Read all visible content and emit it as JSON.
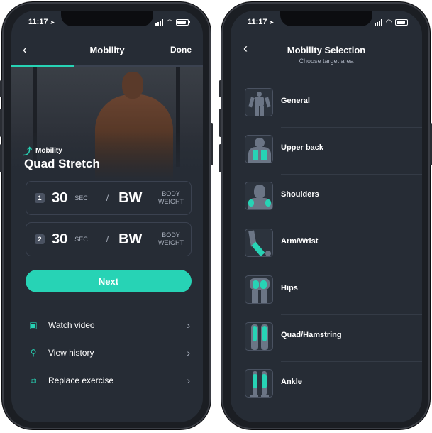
{
  "status_bar": {
    "time": "11:17"
  },
  "left_screen": {
    "nav": {
      "back_icon": "chevron-left",
      "title": "Mobility",
      "done_label": "Done"
    },
    "progress_fraction": 0.33,
    "category": {
      "icon": "mobility-icon",
      "label": "Mobility"
    },
    "exercise_title": "Quad Stretch",
    "sets": [
      {
        "number": "1",
        "reps": "30",
        "unit": "SEC",
        "separator": "/",
        "load": "BW",
        "load_label_line1": "BODY",
        "load_label_line2": "WEIGHT"
      },
      {
        "number": "2",
        "reps": "30",
        "unit": "SEC",
        "separator": "/",
        "load": "BW",
        "load_label_line1": "BODY",
        "load_label_line2": "WEIGHT"
      }
    ],
    "next_label": "Next",
    "menu": [
      {
        "icon": "video-icon",
        "label": "Watch video"
      },
      {
        "icon": "history-icon",
        "label": "View history"
      },
      {
        "icon": "replace-icon",
        "label": "Replace exercise"
      }
    ]
  },
  "right_screen": {
    "nav": {
      "back_icon": "chevron-left",
      "title": "Mobility Selection",
      "subtitle": "Choose target area"
    },
    "areas": [
      {
        "label": "General",
        "icon": "full-body-icon"
      },
      {
        "label": "Upper back",
        "icon": "upper-back-icon"
      },
      {
        "label": "Shoulders",
        "icon": "shoulders-icon"
      },
      {
        "label": "Arm/Wrist",
        "icon": "arm-wrist-icon"
      },
      {
        "label": "Hips",
        "icon": "hips-icon"
      },
      {
        "label": "Quad/Hamstring",
        "icon": "quad-hamstring-icon"
      },
      {
        "label": "Ankle",
        "icon": "ankle-icon"
      }
    ]
  },
  "colors": {
    "accent": "#27d3b5",
    "background": "#262c35",
    "muted": "#a9b0bd"
  }
}
